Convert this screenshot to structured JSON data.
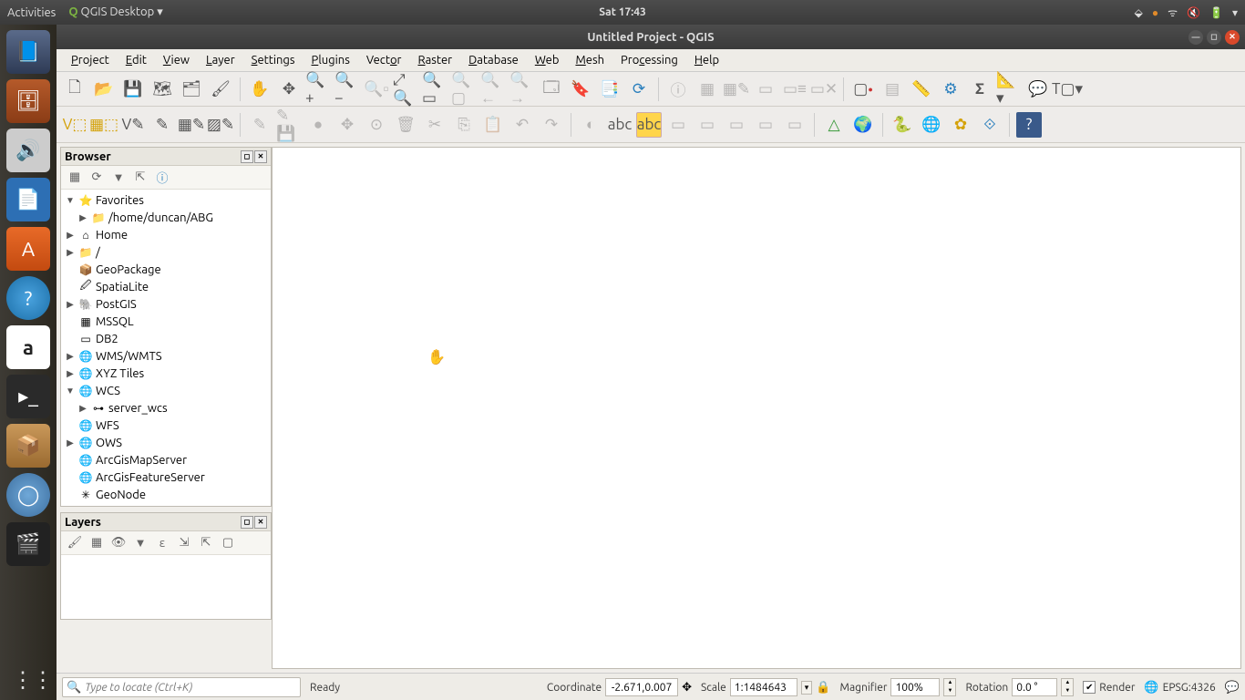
{
  "gnome": {
    "activities": "Activities",
    "app": "QGIS Desktop",
    "clock": "Sat 17:43"
  },
  "title": "Untitled Project - QGIS",
  "menu": [
    "Project",
    "Edit",
    "View",
    "Layer",
    "Settings",
    "Plugins",
    "Vector",
    "Raster",
    "Database",
    "Web",
    "Mesh",
    "Processing",
    "Help"
  ],
  "browser": {
    "title": "Browser",
    "items": [
      {
        "exp": "▼",
        "icon": "⭐",
        "label": "Favorites",
        "cls": ""
      },
      {
        "exp": "▶",
        "icon": "📁",
        "label": "/home/duncan/ABG",
        "cls": "indent1"
      },
      {
        "exp": "▶",
        "icon": "⌂",
        "label": "Home",
        "cls": ""
      },
      {
        "exp": "▶",
        "icon": "📁",
        "label": "/",
        "cls": ""
      },
      {
        "exp": "",
        "icon": "📦",
        "label": "GeoPackage",
        "cls": ""
      },
      {
        "exp": "",
        "icon": "🖉",
        "label": "SpatiaLite",
        "cls": ""
      },
      {
        "exp": "▶",
        "icon": "🐘",
        "label": "PostGIS",
        "cls": ""
      },
      {
        "exp": "",
        "icon": "▦",
        "label": "MSSQL",
        "cls": ""
      },
      {
        "exp": "",
        "icon": "▭",
        "label": "DB2",
        "cls": ""
      },
      {
        "exp": "▶",
        "icon": "🌐",
        "label": "WMS/WMTS",
        "cls": ""
      },
      {
        "exp": "▶",
        "icon": "🌐",
        "label": "XYZ Tiles",
        "cls": ""
      },
      {
        "exp": "▼",
        "icon": "🌐",
        "label": "WCS",
        "cls": ""
      },
      {
        "exp": "▶",
        "icon": "⊶",
        "label": "server_wcs",
        "cls": "indent1"
      },
      {
        "exp": "",
        "icon": "🌐",
        "label": "WFS",
        "cls": ""
      },
      {
        "exp": "▶",
        "icon": "🌐",
        "label": "OWS",
        "cls": ""
      },
      {
        "exp": "",
        "icon": "🌐",
        "label": "ArcGisMapServer",
        "cls": ""
      },
      {
        "exp": "",
        "icon": "🌐",
        "label": "ArcGisFeatureServer",
        "cls": ""
      },
      {
        "exp": "",
        "icon": "✳",
        "label": "GeoNode",
        "cls": ""
      }
    ]
  },
  "layers": {
    "title": "Layers"
  },
  "status": {
    "locator_placeholder": "Type to locate (Ctrl+K)",
    "ready": "Ready",
    "coord_label": "Coordinate",
    "coord_value": "-2.671,0.007",
    "scale_label": "Scale",
    "scale_value": "1:1484643",
    "mag_label": "Magnifier",
    "mag_value": "100%",
    "rot_label": "Rotation",
    "rot_value": "0.0 °",
    "render_label": "Render",
    "crs": "EPSG:4326"
  }
}
